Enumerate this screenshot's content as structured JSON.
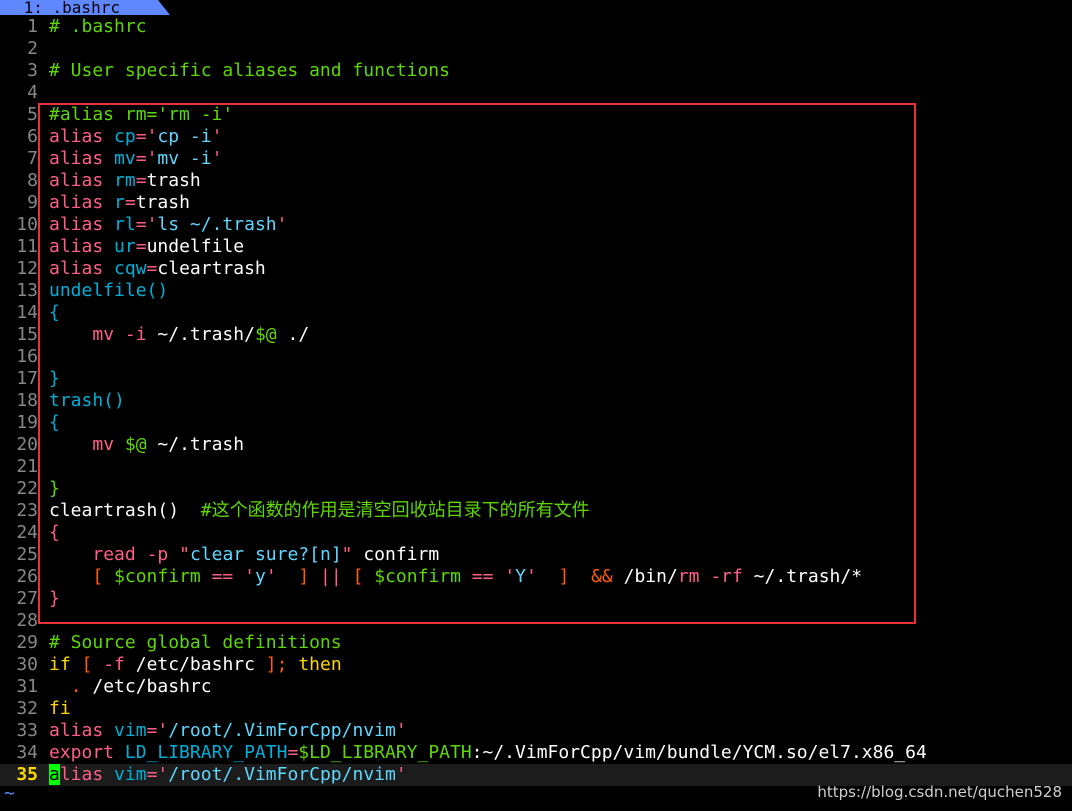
{
  "tabline": {
    "active_tab": " 1: .bashrc"
  },
  "colors": {
    "comment": "#5fd700",
    "keyword": "#ff5f87",
    "function": "#00afd7",
    "string": "#5fd7ff",
    "plain": "#ffffff",
    "conditional": "#ffd700",
    "operator": "#ff5f00",
    "highlight_box": "#e6333a"
  },
  "lines": [
    {
      "n": "1",
      "segs": [
        {
          "t": "# .bashrc",
          "c": "comment"
        }
      ]
    },
    {
      "n": "2",
      "segs": []
    },
    {
      "n": "3",
      "segs": [
        {
          "t": "# User specific aliases and functions",
          "c": "comment"
        }
      ]
    },
    {
      "n": "4",
      "segs": []
    },
    {
      "n": "5",
      "segs": [
        {
          "t": "#alias rm='rm -i'",
          "c": "comment"
        }
      ]
    },
    {
      "n": "6",
      "segs": [
        {
          "t": "alias",
          "c": "keyword"
        },
        {
          "t": " ",
          "c": "plain"
        },
        {
          "t": "cp",
          "c": "function"
        },
        {
          "t": "=",
          "c": "keyword"
        },
        {
          "t": "'",
          "c": "keyword"
        },
        {
          "t": "cp -i",
          "c": "string"
        },
        {
          "t": "'",
          "c": "keyword"
        }
      ]
    },
    {
      "n": "7",
      "segs": [
        {
          "t": "alias",
          "c": "keyword"
        },
        {
          "t": " ",
          "c": "plain"
        },
        {
          "t": "mv",
          "c": "function"
        },
        {
          "t": "=",
          "c": "keyword"
        },
        {
          "t": "'",
          "c": "keyword"
        },
        {
          "t": "mv -i",
          "c": "string"
        },
        {
          "t": "'",
          "c": "keyword"
        }
      ]
    },
    {
      "n": "8",
      "segs": [
        {
          "t": "alias",
          "c": "keyword"
        },
        {
          "t": " ",
          "c": "plain"
        },
        {
          "t": "rm",
          "c": "function"
        },
        {
          "t": "=",
          "c": "keyword"
        },
        {
          "t": "trash",
          "c": "plain"
        }
      ]
    },
    {
      "n": "9",
      "segs": [
        {
          "t": "alias",
          "c": "keyword"
        },
        {
          "t": " ",
          "c": "plain"
        },
        {
          "t": "r",
          "c": "function"
        },
        {
          "t": "=",
          "c": "keyword"
        },
        {
          "t": "trash",
          "c": "plain"
        }
      ]
    },
    {
      "n": "10",
      "segs": [
        {
          "t": "alias",
          "c": "keyword"
        },
        {
          "t": " ",
          "c": "plain"
        },
        {
          "t": "rl",
          "c": "function"
        },
        {
          "t": "=",
          "c": "keyword"
        },
        {
          "t": "'",
          "c": "keyword"
        },
        {
          "t": "ls ~/.trash",
          "c": "string"
        },
        {
          "t": "'",
          "c": "keyword"
        }
      ]
    },
    {
      "n": "11",
      "segs": [
        {
          "t": "alias",
          "c": "keyword"
        },
        {
          "t": " ",
          "c": "plain"
        },
        {
          "t": "ur",
          "c": "function"
        },
        {
          "t": "=",
          "c": "keyword"
        },
        {
          "t": "undelfile",
          "c": "plain"
        }
      ]
    },
    {
      "n": "12",
      "segs": [
        {
          "t": "alias",
          "c": "keyword"
        },
        {
          "t": " ",
          "c": "plain"
        },
        {
          "t": "cqw",
          "c": "function"
        },
        {
          "t": "=",
          "c": "keyword"
        },
        {
          "t": "cleartrash",
          "c": "plain"
        }
      ]
    },
    {
      "n": "13",
      "segs": [
        {
          "t": "undelfile()",
          "c": "function"
        }
      ]
    },
    {
      "n": "14",
      "segs": [
        {
          "t": "{",
          "c": "function"
        }
      ]
    },
    {
      "n": "15",
      "segs": [
        {
          "t": "    ",
          "c": "plain"
        },
        {
          "t": "mv",
          "c": "keyword"
        },
        {
          "t": " ",
          "c": "plain"
        },
        {
          "t": "-i",
          "c": "keyword"
        },
        {
          "t": " ~/.trash/",
          "c": "plain"
        },
        {
          "t": "$@",
          "c": "comment"
        },
        {
          "t": " ./",
          "c": "plain"
        }
      ]
    },
    {
      "n": "16",
      "segs": []
    },
    {
      "n": "17",
      "segs": [
        {
          "t": "}",
          "c": "function"
        }
      ]
    },
    {
      "n": "18",
      "segs": [
        {
          "t": "trash()",
          "c": "function"
        }
      ]
    },
    {
      "n": "19",
      "segs": [
        {
          "t": "{",
          "c": "function"
        }
      ]
    },
    {
      "n": "20",
      "segs": [
        {
          "t": "    ",
          "c": "plain"
        },
        {
          "t": "mv",
          "c": "keyword"
        },
        {
          "t": " ",
          "c": "plain"
        },
        {
          "t": "$@",
          "c": "comment"
        },
        {
          "t": " ~/.trash",
          "c": "plain"
        }
      ]
    },
    {
      "n": "21",
      "segs": []
    },
    {
      "n": "22",
      "segs": [
        {
          "t": "}",
          "c": "comment"
        }
      ]
    },
    {
      "n": "23",
      "segs": [
        {
          "t": "cleartrash()",
          "c": "plain"
        },
        {
          "t": "  ",
          "c": "plain"
        },
        {
          "t": "#这个函数的作用是清空回收站目录下的所有文件",
          "c": "comment"
        }
      ]
    },
    {
      "n": "24",
      "segs": [
        {
          "t": "{",
          "c": "keyword"
        }
      ]
    },
    {
      "n": "25",
      "segs": [
        {
          "t": "    ",
          "c": "plain"
        },
        {
          "t": "read",
          "c": "keyword"
        },
        {
          "t": " ",
          "c": "plain"
        },
        {
          "t": "-p",
          "c": "keyword"
        },
        {
          "t": " ",
          "c": "plain"
        },
        {
          "t": "\"",
          "c": "keyword"
        },
        {
          "t": "clear sure?[n]",
          "c": "string"
        },
        {
          "t": "\"",
          "c": "keyword"
        },
        {
          "t": " confirm",
          "c": "plain"
        }
      ]
    },
    {
      "n": "26",
      "segs": [
        {
          "t": "    ",
          "c": "plain"
        },
        {
          "t": "[",
          "c": "operator"
        },
        {
          "t": " ",
          "c": "plain"
        },
        {
          "t": "$confirm",
          "c": "comment"
        },
        {
          "t": " ",
          "c": "plain"
        },
        {
          "t": "==",
          "c": "keyword"
        },
        {
          "t": " ",
          "c": "plain"
        },
        {
          "t": "'",
          "c": "keyword"
        },
        {
          "t": "y",
          "c": "string"
        },
        {
          "t": "'",
          "c": "keyword"
        },
        {
          "t": "  ",
          "c": "plain"
        },
        {
          "t": "]",
          "c": "operator"
        },
        {
          "t": " ",
          "c": "plain"
        },
        {
          "t": "||",
          "c": "keyword"
        },
        {
          "t": " ",
          "c": "plain"
        },
        {
          "t": "[",
          "c": "operator"
        },
        {
          "t": " ",
          "c": "plain"
        },
        {
          "t": "$confirm",
          "c": "comment"
        },
        {
          "t": " ",
          "c": "plain"
        },
        {
          "t": "==",
          "c": "keyword"
        },
        {
          "t": " ",
          "c": "plain"
        },
        {
          "t": "'",
          "c": "keyword"
        },
        {
          "t": "Y",
          "c": "string"
        },
        {
          "t": "'",
          "c": "keyword"
        },
        {
          "t": "  ",
          "c": "plain"
        },
        {
          "t": "]",
          "c": "operator"
        },
        {
          "t": "  ",
          "c": "plain"
        },
        {
          "t": "&&",
          "c": "operator"
        },
        {
          "t": " /bin/",
          "c": "plain"
        },
        {
          "t": "rm",
          "c": "keyword"
        },
        {
          "t": " ",
          "c": "plain"
        },
        {
          "t": "-rf",
          "c": "keyword"
        },
        {
          "t": " ~/.trash/*",
          "c": "plain"
        }
      ]
    },
    {
      "n": "27",
      "segs": [
        {
          "t": "}",
          "c": "keyword"
        }
      ]
    },
    {
      "n": "28",
      "segs": []
    },
    {
      "n": "29",
      "segs": [
        {
          "t": "# Source global definitions",
          "c": "comment"
        }
      ]
    },
    {
      "n": "30",
      "segs": [
        {
          "t": "if",
          "c": "conditional"
        },
        {
          "t": " ",
          "c": "plain"
        },
        {
          "t": "[",
          "c": "operator"
        },
        {
          "t": " ",
          "c": "plain"
        },
        {
          "t": "-f",
          "c": "keyword"
        },
        {
          "t": " /etc/bashrc ",
          "c": "plain"
        },
        {
          "t": "];",
          "c": "operator"
        },
        {
          "t": " ",
          "c": "plain"
        },
        {
          "t": "then",
          "c": "conditional"
        }
      ]
    },
    {
      "n": "31",
      "segs": [
        {
          "t": "  ",
          "c": "plain"
        },
        {
          "t": ".",
          "c": "operator"
        },
        {
          "t": " /etc/bashrc",
          "c": "plain"
        }
      ]
    },
    {
      "n": "32",
      "segs": [
        {
          "t": "fi",
          "c": "conditional"
        }
      ]
    },
    {
      "n": "33",
      "segs": [
        {
          "t": "alias",
          "c": "keyword"
        },
        {
          "t": " ",
          "c": "plain"
        },
        {
          "t": "vim",
          "c": "function"
        },
        {
          "t": "=",
          "c": "keyword"
        },
        {
          "t": "'",
          "c": "keyword"
        },
        {
          "t": "/root/.VimForCpp/nvim",
          "c": "string"
        },
        {
          "t": "'",
          "c": "keyword"
        }
      ]
    },
    {
      "n": "34",
      "segs": [
        {
          "t": "export",
          "c": "keyword"
        },
        {
          "t": " ",
          "c": "plain"
        },
        {
          "t": "LD_LIBRARY_PATH",
          "c": "function"
        },
        {
          "t": "=",
          "c": "keyword"
        },
        {
          "t": "$LD_LIBRARY_PATH",
          "c": "comment"
        },
        {
          "t": ":~/.VimForCpp/vim/bundle/YCM.so/el7.x86_64",
          "c": "plain"
        }
      ]
    },
    {
      "n": "35",
      "cursor": true,
      "segs": [
        {
          "t": "a",
          "c": "cursor"
        },
        {
          "t": "lias",
          "c": "keyword"
        },
        {
          "t": " ",
          "c": "plain"
        },
        {
          "t": "vim",
          "c": "function"
        },
        {
          "t": "=",
          "c": "keyword"
        },
        {
          "t": "'",
          "c": "keyword"
        },
        {
          "t": "/root/.VimForCpp/nvim",
          "c": "string"
        },
        {
          "t": "'",
          "c": "keyword"
        }
      ]
    }
  ],
  "tilde": "~",
  "watermark": "https://blog.csdn.net/quchen528"
}
